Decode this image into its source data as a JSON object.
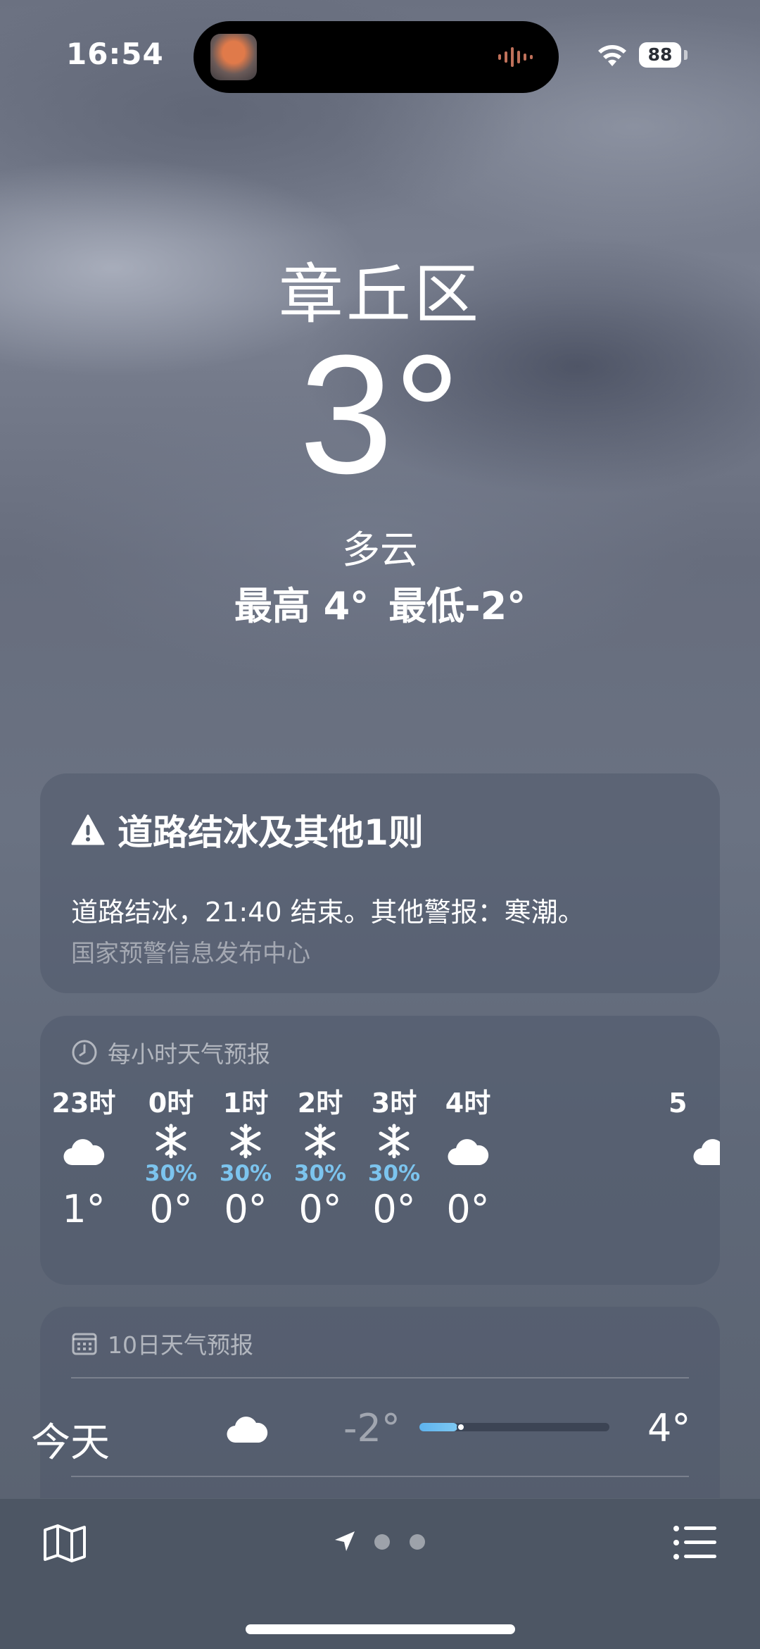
{
  "status_bar": {
    "time": "16:54",
    "battery": "88"
  },
  "hero": {
    "city": "章丘区",
    "temperature": "3°",
    "condition": "多云",
    "high": "最高 4°",
    "low": "最低-2°"
  },
  "alert": {
    "title": "道路结冰及其他1则",
    "body": "道路结冰，21:40 结束。其他警报：寒潮。",
    "source": "国家预警信息发布中心",
    "icon": "warning-triangle-icon"
  },
  "hourly": {
    "header": "每小时天气预报",
    "icon": "clock-icon",
    "items": [
      {
        "time": "23时",
        "icon": "cloud-icon",
        "pop": "",
        "temp": "1°"
      },
      {
        "time": "0时",
        "icon": "snowflake-icon",
        "pop": "30%",
        "temp": "0°"
      },
      {
        "time": "1时",
        "icon": "snowflake-icon",
        "pop": "30%",
        "temp": "0°"
      },
      {
        "time": "2时",
        "icon": "snowflake-icon",
        "pop": "30%",
        "temp": "0°"
      },
      {
        "time": "3时",
        "icon": "snowflake-icon",
        "pop": "30%",
        "temp": "0°"
      },
      {
        "time": "4时",
        "icon": "cloud-icon",
        "pop": "",
        "temp": "0°"
      },
      {
        "time": "5",
        "icon": "cloud-icon",
        "pop": "",
        "temp": ""
      }
    ]
  },
  "daily": {
    "header": "10日天气预报",
    "icon": "calendar-icon",
    "items": [
      {
        "day": "今天",
        "icon": "cloud-icon",
        "low": "-2°",
        "high": "4°",
        "range_fill": 0.2,
        "current_marker": 0.22
      }
    ]
  },
  "bottom_bar": {
    "left_icon": "map-icon",
    "right_icon": "list-icon",
    "page_indicator": [
      "location-arrow-icon",
      "dot",
      "dot"
    ]
  },
  "colors": {
    "precip": "#7cc4ee",
    "card_bg": "rgba(80,90,108,0.55)",
    "range_bar": "#5eb3ee"
  }
}
